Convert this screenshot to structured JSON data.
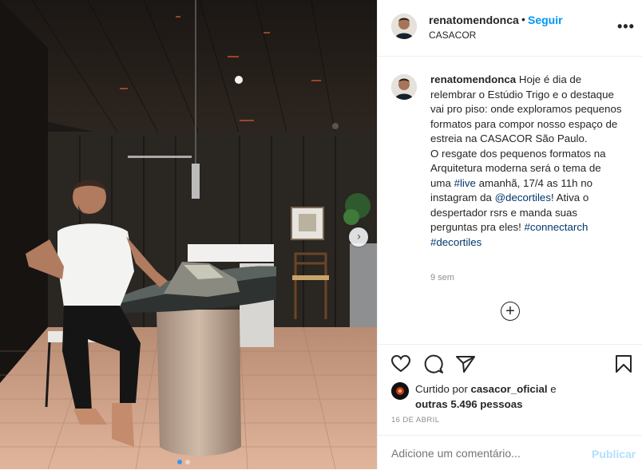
{
  "post": {
    "username": "renatomendonca",
    "separator": "•",
    "follow_label": "Seguir",
    "location": "CASACOR",
    "more_label": "•••"
  },
  "caption": {
    "username": "renatomendonca",
    "text_1": " Hoje é dia de relembrar o Estúdio Trigo e o destaque vai pro piso: onde exploramos pequenos formatos para compor nosso espaço de estreia na CASACOR São Paulo.",
    "text_2": "O resgate dos pequenos formatos na Arquitetura moderna será o tema de uma ",
    "tag_live": "#live",
    "text_3": " amanhã, 17/4 as 11h no instagram da ",
    "tag_decortiles_mention": "@decortiles",
    "text_4": "! Ativa o despertador rsrs e manda suas perguntas pra eles! ",
    "tag_connectarch": "#connectarch",
    "tag_decortiles": "#decortiles",
    "time_ago": "9 sem"
  },
  "load_more_label": "+",
  "likes": {
    "prefix": "Curtido por ",
    "user": "casacor_oficial",
    "middle": " e",
    "others": "outras 5.496 pessoas"
  },
  "date": "16 DE ABRIL",
  "comment": {
    "placeholder": "Adicione um comentário...",
    "publish_label": "Publicar"
  },
  "carousel": {
    "next_label": "›",
    "total": 2,
    "active_index": 0
  },
  "colors": {
    "link_blue": "#0095f6",
    "hashtag": "#00376b",
    "publish_disabled": "#b2dffc",
    "muted": "#8e8e8e"
  },
  "icons": [
    "heart-icon",
    "comment-icon",
    "share-icon",
    "bookmark-icon",
    "more-options-icon",
    "plus-circle-icon",
    "chevron-right-icon"
  ]
}
